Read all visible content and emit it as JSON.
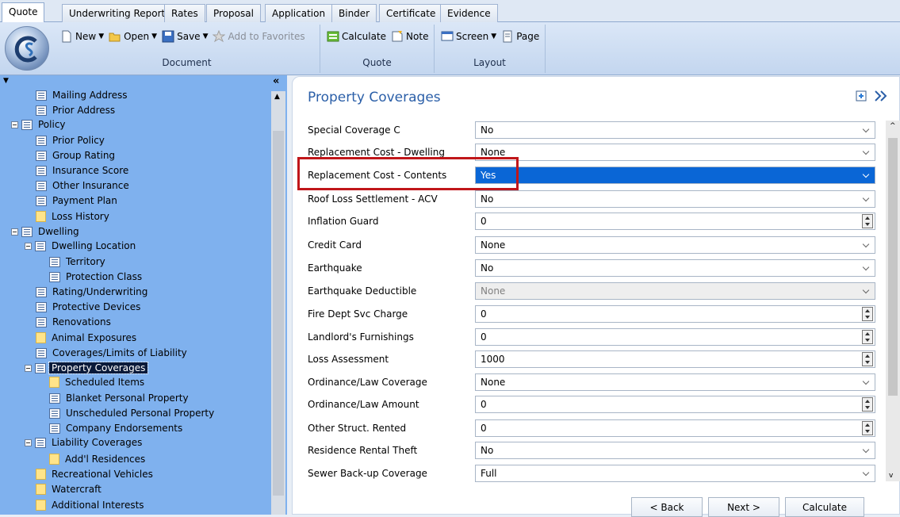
{
  "tabs": [
    "Quote",
    "Underwriting Reports",
    "Rates",
    "Proposal",
    "Application",
    "Binder",
    "Certificate",
    "Evidence"
  ],
  "ribbon": {
    "document": {
      "title": "Document",
      "new": "New",
      "open": "Open",
      "save": "Save",
      "add_favorites": "Add to Favorites"
    },
    "quote": {
      "title": "Quote",
      "calculate": "Calculate",
      "note": "Note"
    },
    "layout": {
      "title": "Layout",
      "screen": "Screen",
      "page": "Page"
    }
  },
  "tree": {
    "collapse_glyph": "«",
    "items": [
      {
        "label": "Mailing Address",
        "icon": "doc"
      },
      {
        "label": "Prior Address",
        "icon": "doc"
      },
      {
        "label": "Policy",
        "icon": "doc",
        "expanded": true
      },
      {
        "label": "Prior Policy",
        "icon": "doc"
      },
      {
        "label": "Group Rating",
        "icon": "doc"
      },
      {
        "label": "Insurance Score",
        "icon": "doc"
      },
      {
        "label": "Other Insurance",
        "icon": "doc"
      },
      {
        "label": "Payment Plan",
        "icon": "doc"
      },
      {
        "label": "Loss History",
        "icon": "folder"
      },
      {
        "label": "Dwelling",
        "icon": "doc",
        "expanded": true
      },
      {
        "label": "Dwelling Location",
        "icon": "doc",
        "expanded": true
      },
      {
        "label": "Territory",
        "icon": "doc"
      },
      {
        "label": "Protection Class",
        "icon": "doc"
      },
      {
        "label": "Rating/Underwriting",
        "icon": "doc"
      },
      {
        "label": "Protective Devices",
        "icon": "doc"
      },
      {
        "label": "Renovations",
        "icon": "doc"
      },
      {
        "label": "Animal Exposures",
        "icon": "folder"
      },
      {
        "label": "Coverages/Limits of Liability",
        "icon": "doc"
      },
      {
        "label": "Property Coverages",
        "icon": "doc",
        "expanded": true,
        "selected": true
      },
      {
        "label": "Scheduled Items",
        "icon": "folder"
      },
      {
        "label": "Blanket Personal Property",
        "icon": "doc"
      },
      {
        "label": "Unscheduled Personal Property",
        "icon": "doc"
      },
      {
        "label": "Company Endorsements",
        "icon": "doc"
      },
      {
        "label": "Liability Coverages",
        "icon": "doc",
        "expanded": true
      },
      {
        "label": "Add'l Residences",
        "icon": "folder"
      },
      {
        "label": "Recreational Vehicles",
        "icon": "folder"
      },
      {
        "label": "Watercraft",
        "icon": "folder"
      },
      {
        "label": "Additional Interests",
        "icon": "folder"
      }
    ]
  },
  "main": {
    "title": "Property Coverages",
    "fields": [
      {
        "label": "Special Coverage C",
        "value": "No",
        "type": "dropdown"
      },
      {
        "label": "Replacement Cost - Dwelling",
        "value": "None",
        "type": "dropdown"
      },
      {
        "label": "Replacement Cost - Contents",
        "value": "Yes",
        "type": "dropdown",
        "highlighted": true
      },
      {
        "label": "Roof Loss Settlement - ACV",
        "value": "No",
        "type": "dropdown"
      },
      {
        "label": "Inflation Guard",
        "value": "0",
        "type": "spinner"
      },
      {
        "label": "Credit Card",
        "value": "None",
        "type": "dropdown"
      },
      {
        "label": "Earthquake",
        "value": "No",
        "type": "dropdown"
      },
      {
        "label": "Earthquake Deductible",
        "value": "None",
        "type": "dropdown",
        "disabled": true
      },
      {
        "label": "Fire Dept Svc Charge",
        "value": "0",
        "type": "spinner"
      },
      {
        "label": "Landlord's Furnishings",
        "value": "0",
        "type": "spinner"
      },
      {
        "label": "Loss Assessment",
        "value": "1000",
        "type": "spinner"
      },
      {
        "label": "Ordinance/Law Coverage",
        "value": "None",
        "type": "dropdown"
      },
      {
        "label": "Ordinance/Law Amount",
        "value": "0",
        "type": "spinner"
      },
      {
        "label": "Other Struct. Rented",
        "value": "0",
        "type": "spinner"
      },
      {
        "label": "Residence Rental Theft",
        "value": "No",
        "type": "dropdown"
      },
      {
        "label": "Sewer Back-up Coverage",
        "value": "Full",
        "type": "dropdown"
      }
    ],
    "buttons": {
      "back": "< Back",
      "next": "Next >",
      "calculate": "Calculate"
    }
  },
  "colors": {
    "tree_bg": "#7fb1ee",
    "title": "#2b5fa8",
    "highlight": "#0a66d6",
    "annotation": "#c0161a"
  }
}
